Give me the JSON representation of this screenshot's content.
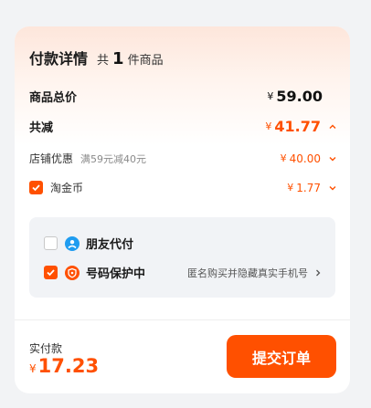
{
  "payment": {
    "title": "付款详情",
    "count_prefix": "共",
    "count": "1",
    "count_suffix": "件商品"
  },
  "rows": {
    "total": {
      "label": "商品总价",
      "currency": "¥",
      "amount": "59.00"
    },
    "discount": {
      "label": "共减",
      "currency": "¥",
      "amount": "41.77"
    },
    "store": {
      "label": "店铺优惠",
      "hint": "满59元减40元",
      "currency": "¥",
      "amount": "40.00"
    },
    "coins": {
      "label": "淘金币",
      "currency": "¥",
      "amount": "1.77",
      "checked": true
    }
  },
  "options": {
    "friend_pay": {
      "label": "朋友代付",
      "checked": false
    },
    "number_protect": {
      "label": "号码保护中",
      "desc": "匿名购买并隐藏真实手机号",
      "checked": true
    }
  },
  "footer": {
    "label": "实付款",
    "currency": "¥",
    "amount": "17.23",
    "submit_label": "提交订单"
  },
  "colors": {
    "accent": "#ff5000",
    "blue_icon": "#1f9cf0",
    "panel_bg": "#f1f3f6"
  },
  "icons": [
    "chevron-up-icon",
    "chevron-down-icon",
    "chevron-right-icon",
    "friend-pay-icon",
    "shield-phone-icon",
    "checkmark-icon"
  ]
}
